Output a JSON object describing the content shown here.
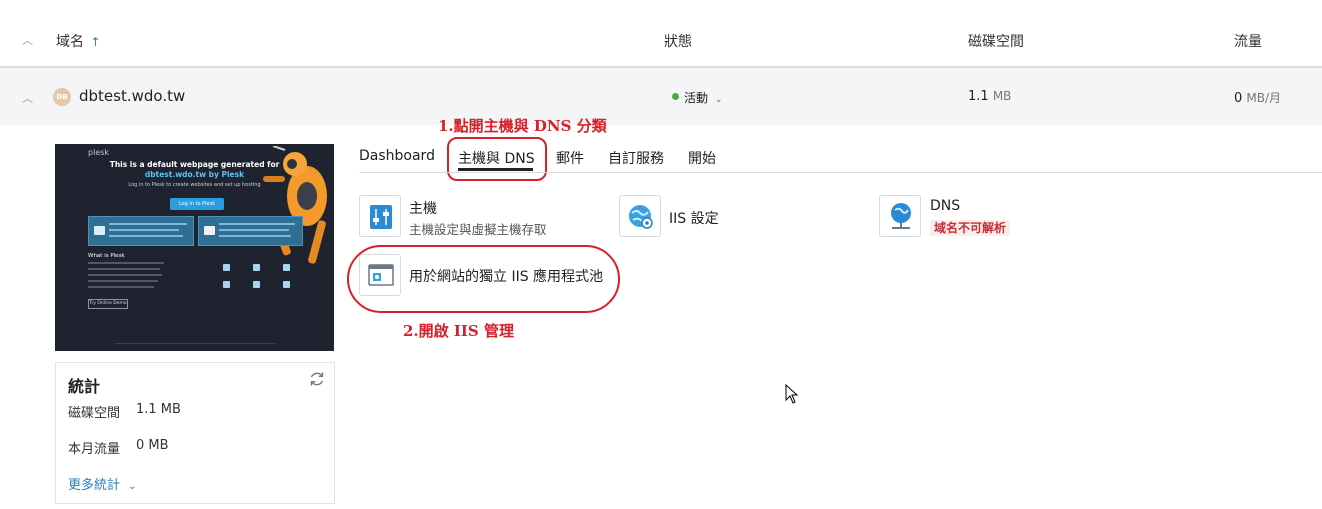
{
  "table": {
    "headers": {
      "domain": "域名",
      "status": "狀態",
      "disk": "磁碟空間",
      "traffic": "流量"
    },
    "sort_arrow": "↑",
    "row": {
      "avatar": "DB",
      "domain": "dbtest.wdo.tw",
      "status": "活動",
      "disk_value": "1.1",
      "disk_unit": "MB",
      "traffic_value": "0",
      "traffic_unit": "MB/月"
    }
  },
  "preview": {
    "brand": "plesk",
    "title_line1": "This is a default webpage generated for",
    "title_line2": "dbtest.wdo.tw by Plesk",
    "subtitle": "Log in to Plesk to create websites and set up hosting",
    "login_button": "Log in to Plesk",
    "what_is": "What is Plesk",
    "try_button": "Try Online Demo"
  },
  "stats": {
    "title": "統計",
    "disk_label": "磁碟空間",
    "disk_value": "1.1 MB",
    "traffic_label": "本月流量",
    "traffic_value": "0 MB",
    "more": "更多統計"
  },
  "annotations": {
    "step1": "1.點開主機與 DNS 分類",
    "step2": "2.開啟 IIS 管理"
  },
  "tabs": [
    "Dashboard",
    "主機與 DNS",
    "郵件",
    "自訂服務",
    "開始"
  ],
  "tools": {
    "host": {
      "title": "主機",
      "desc": "主機設定與虛擬主機存取"
    },
    "iis": {
      "title": "IIS 設定"
    },
    "dns": {
      "title": "DNS",
      "badge": "域名不可解析"
    },
    "pool": {
      "title": "用於網站的獨立 IIS 應用程式池"
    }
  },
  "colors": {
    "accent": "#2a7fc0",
    "annotation": "#d6202a",
    "active_status": "#4aaa3d",
    "icon_blue": "#2a8ad4"
  }
}
